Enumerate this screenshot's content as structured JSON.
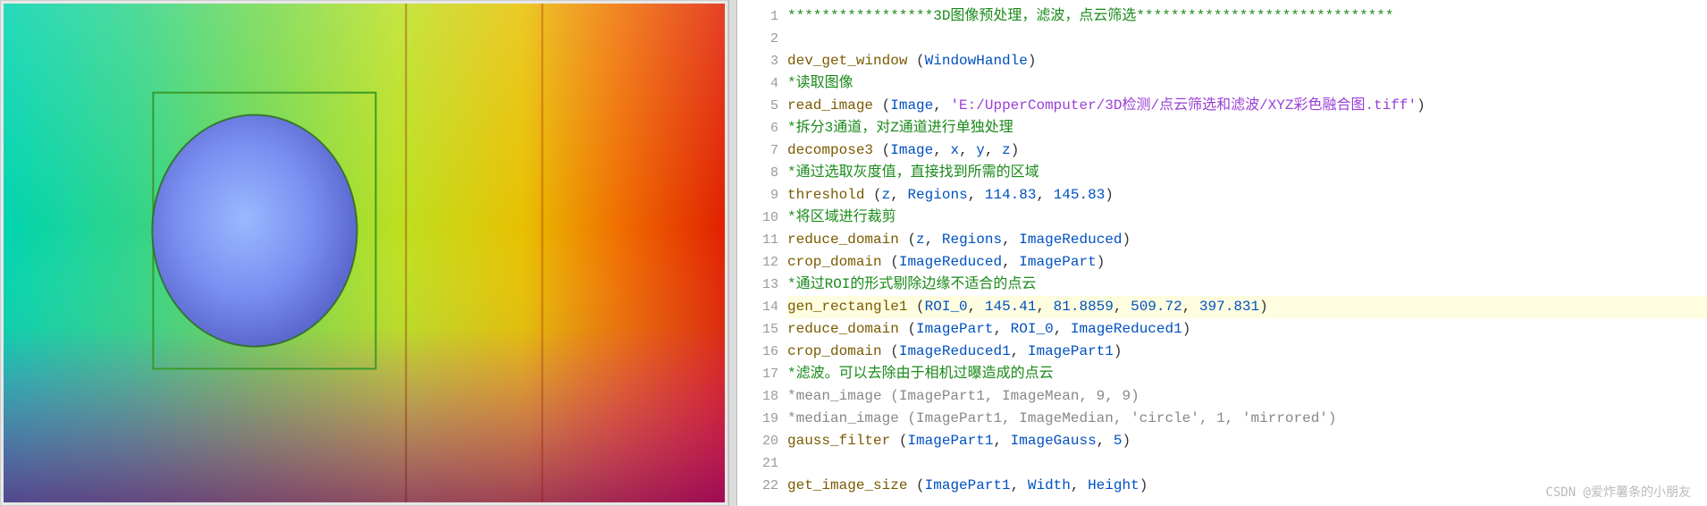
{
  "editor": {
    "current_line": 7,
    "breakpoint_marker_line": 14,
    "lines": [
      {
        "n": 1,
        "type": "comment",
        "text": "*****************3D图像预处理，滤波，点云筛选******************************"
      },
      {
        "n": 2,
        "type": "blank",
        "text": ""
      },
      {
        "n": 3,
        "type": "call",
        "op": "dev_get_window",
        "args": [
          {
            "t": "ident",
            "v": "WindowHandle"
          }
        ]
      },
      {
        "n": 4,
        "type": "comment",
        "text": "*读取图像"
      },
      {
        "n": 5,
        "type": "call",
        "op": "read_image",
        "args": [
          {
            "t": "ident",
            "v": "Image"
          },
          {
            "t": "string",
            "v": "'E:/UpperComputer/3D检测/点云筛选和滤波/XYZ彩色融合图.tiff'"
          }
        ]
      },
      {
        "n": 6,
        "type": "comment",
        "text": "*拆分3通道，对Z通道进行单独处理"
      },
      {
        "n": 7,
        "type": "call",
        "op": "decompose3",
        "args": [
          {
            "t": "ident",
            "v": "Image"
          },
          {
            "t": "ident",
            "v": "x"
          },
          {
            "t": "ident",
            "v": "y"
          },
          {
            "t": "ident",
            "v": "z"
          }
        ]
      },
      {
        "n": 8,
        "type": "comment",
        "text": "*通过选取灰度值，直接找到所需的区域"
      },
      {
        "n": 9,
        "type": "call",
        "op": "threshold",
        "args": [
          {
            "t": "ident",
            "v": "z"
          },
          {
            "t": "ident",
            "v": "Regions"
          },
          {
            "t": "num",
            "v": "114.83"
          },
          {
            "t": "num",
            "v": "145.83"
          }
        ]
      },
      {
        "n": 10,
        "type": "comment",
        "text": "*将区域进行裁剪"
      },
      {
        "n": 11,
        "type": "call",
        "op": "reduce_domain",
        "args": [
          {
            "t": "ident",
            "v": "z"
          },
          {
            "t": "ident",
            "v": "Regions"
          },
          {
            "t": "ident",
            "v": "ImageReduced"
          }
        ]
      },
      {
        "n": 12,
        "type": "call",
        "op": "crop_domain",
        "args": [
          {
            "t": "ident",
            "v": "ImageReduced"
          },
          {
            "t": "ident",
            "v": "ImagePart"
          }
        ]
      },
      {
        "n": 13,
        "type": "comment",
        "text": "*通过ROI的形式剔除边缘不适合的点云"
      },
      {
        "n": 14,
        "type": "call",
        "op": "gen_rectangle1",
        "highlight": true,
        "args": [
          {
            "t": "ident",
            "v": "ROI_0"
          },
          {
            "t": "num",
            "v": "145.41"
          },
          {
            "t": "num",
            "v": "81.8859"
          },
          {
            "t": "num",
            "v": "509.72"
          },
          {
            "t": "num",
            "v": "397.831"
          }
        ]
      },
      {
        "n": 15,
        "type": "call",
        "op": "reduce_domain",
        "args": [
          {
            "t": "ident",
            "v": "ImagePart"
          },
          {
            "t": "ident",
            "v": "ROI_0"
          },
          {
            "t": "ident",
            "v": "ImageReduced1"
          }
        ]
      },
      {
        "n": 16,
        "type": "call",
        "op": "crop_domain",
        "args": [
          {
            "t": "ident",
            "v": "ImageReduced1"
          },
          {
            "t": "ident",
            "v": "ImagePart1"
          }
        ]
      },
      {
        "n": 17,
        "type": "comment",
        "text": "*滤波。可以去除由于相机过曝造成的点云"
      },
      {
        "n": 18,
        "type": "commented",
        "text": "*mean_image (ImagePart1, ImageMean, 9, 9)"
      },
      {
        "n": 19,
        "type": "commented",
        "text": "*median_image (ImagePart1, ImageMedian, 'circle', 1, 'mirrored')"
      },
      {
        "n": 20,
        "type": "call",
        "op": "gauss_filter",
        "args": [
          {
            "t": "ident",
            "v": "ImagePart1"
          },
          {
            "t": "ident",
            "v": "ImageGauss"
          },
          {
            "t": "num",
            "v": "5"
          }
        ]
      },
      {
        "n": 21,
        "type": "blank",
        "text": ""
      },
      {
        "n": 22,
        "type": "call",
        "op": "get_image_size",
        "args": [
          {
            "t": "ident",
            "v": "ImagePart1"
          },
          {
            "t": "ident",
            "v": "Width"
          },
          {
            "t": "ident",
            "v": "Height"
          }
        ]
      }
    ]
  },
  "image_panel": {
    "description": "3D-XYZ-color-fusion-image"
  },
  "watermark": "CSDN @爱炸薯条的小朋友"
}
